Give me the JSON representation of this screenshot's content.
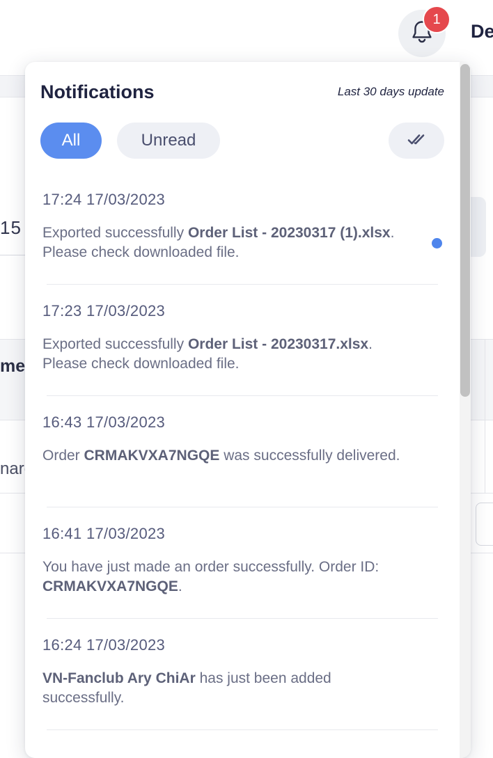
{
  "header": {
    "user_label": "De",
    "notification_count": "1"
  },
  "background": {
    "input_value": "15",
    "table_header_fragment": "mer",
    "row_fragment": "narc"
  },
  "panel": {
    "title": "Notifications",
    "subtitle": "Last 30 days update",
    "tabs": [
      {
        "label": "All",
        "active": true
      },
      {
        "label": "Unread",
        "active": false
      }
    ],
    "mark_all_read_icon": "double-check-icon"
  },
  "notifications": [
    {
      "time": "17:24 17/03/2023",
      "unread": true,
      "parts": [
        {
          "text": "Exported successfully ",
          "bold": false
        },
        {
          "text": "Order List - 20230317 (1).xlsx",
          "bold": true
        },
        {
          "text": ". Please check downloaded file.",
          "bold": false
        }
      ]
    },
    {
      "time": "17:23 17/03/2023",
      "unread": false,
      "parts": [
        {
          "text": "Exported successfully ",
          "bold": false
        },
        {
          "text": "Order List - 20230317.xlsx",
          "bold": true
        },
        {
          "text": ". Please check downloaded file.",
          "bold": false
        }
      ]
    },
    {
      "time": "16:43 17/03/2023",
      "unread": false,
      "parts": [
        {
          "text": "Order ",
          "bold": false
        },
        {
          "text": "CRMAKVXA7NGQE",
          "bold": true
        },
        {
          "text": " was successfully delivered.",
          "bold": false
        }
      ]
    },
    {
      "time": "16:41 17/03/2023",
      "unread": false,
      "parts": [
        {
          "text": "You have just made an order successfully. Order ID: ",
          "bold": false
        },
        {
          "text": "CRMAKVXA7NGQE",
          "bold": true
        },
        {
          "text": ".",
          "bold": false
        }
      ]
    },
    {
      "time": "16:24 17/03/2023",
      "unread": false,
      "parts": [
        {
          "text": "VN-Fanclub Ary ChiAr",
          "bold": true
        },
        {
          "text": " has just been added successfully.",
          "bold": false
        }
      ]
    }
  ],
  "colors": {
    "accent": "#5b8def",
    "unread_dot": "#4e85ec",
    "badge": "#e5484d"
  }
}
